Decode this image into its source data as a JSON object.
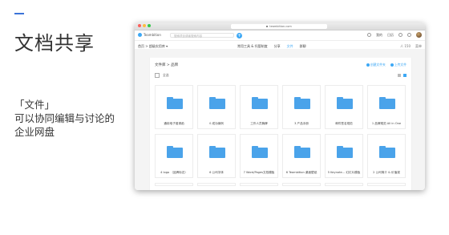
{
  "slide": {
    "title": "文档共享",
    "subtitle_lines": [
      "「文件」",
      "可以协同编辑与讨论的",
      "企业网盘"
    ]
  },
  "browser": {
    "url": "teambition.com",
    "app_name": "Teambition",
    "search_placeholder": "搜索项目或者搜索内容",
    "add_label": "+",
    "right_items": [
      "我的",
      "日历"
    ]
  },
  "project": {
    "breadcrumb": "首页 > 超级实用库 ▾",
    "nav": [
      "常用工具 & 托管制度",
      "分享",
      "文件",
      "群聊"
    ],
    "active_nav": "文件",
    "right_items": [
      "人 150",
      "菜单"
    ]
  },
  "files": {
    "path": "文件库 > 品牌",
    "actions": [
      "创建文件夹",
      "上传文件"
    ],
    "select_all": "全选",
    "folders": [
      {
        "name": "通用电子邀请函"
      },
      {
        "name": "0 成功案例"
      },
      {
        "name": "工作人员胸牌"
      },
      {
        "name": "3 产品手册"
      },
      {
        "name": "邮件签名规范"
      },
      {
        "name": "1 品牌规范 All in One"
      },
      {
        "name": "4 logo （品牌标志）"
      },
      {
        "name": "6 公司字体"
      },
      {
        "name": "7 Word/Pages文档模板"
      },
      {
        "name": "6 Teambition 桌面壁纸"
      },
      {
        "name": "5 Keynote... 幻灯片模板"
      },
      {
        "name": "2 公司简介 & 价值观"
      }
    ]
  },
  "colors": {
    "accent": "#3da8f5",
    "folder": "#4aa3ea",
    "slide_accent": "#3b73d8"
  }
}
